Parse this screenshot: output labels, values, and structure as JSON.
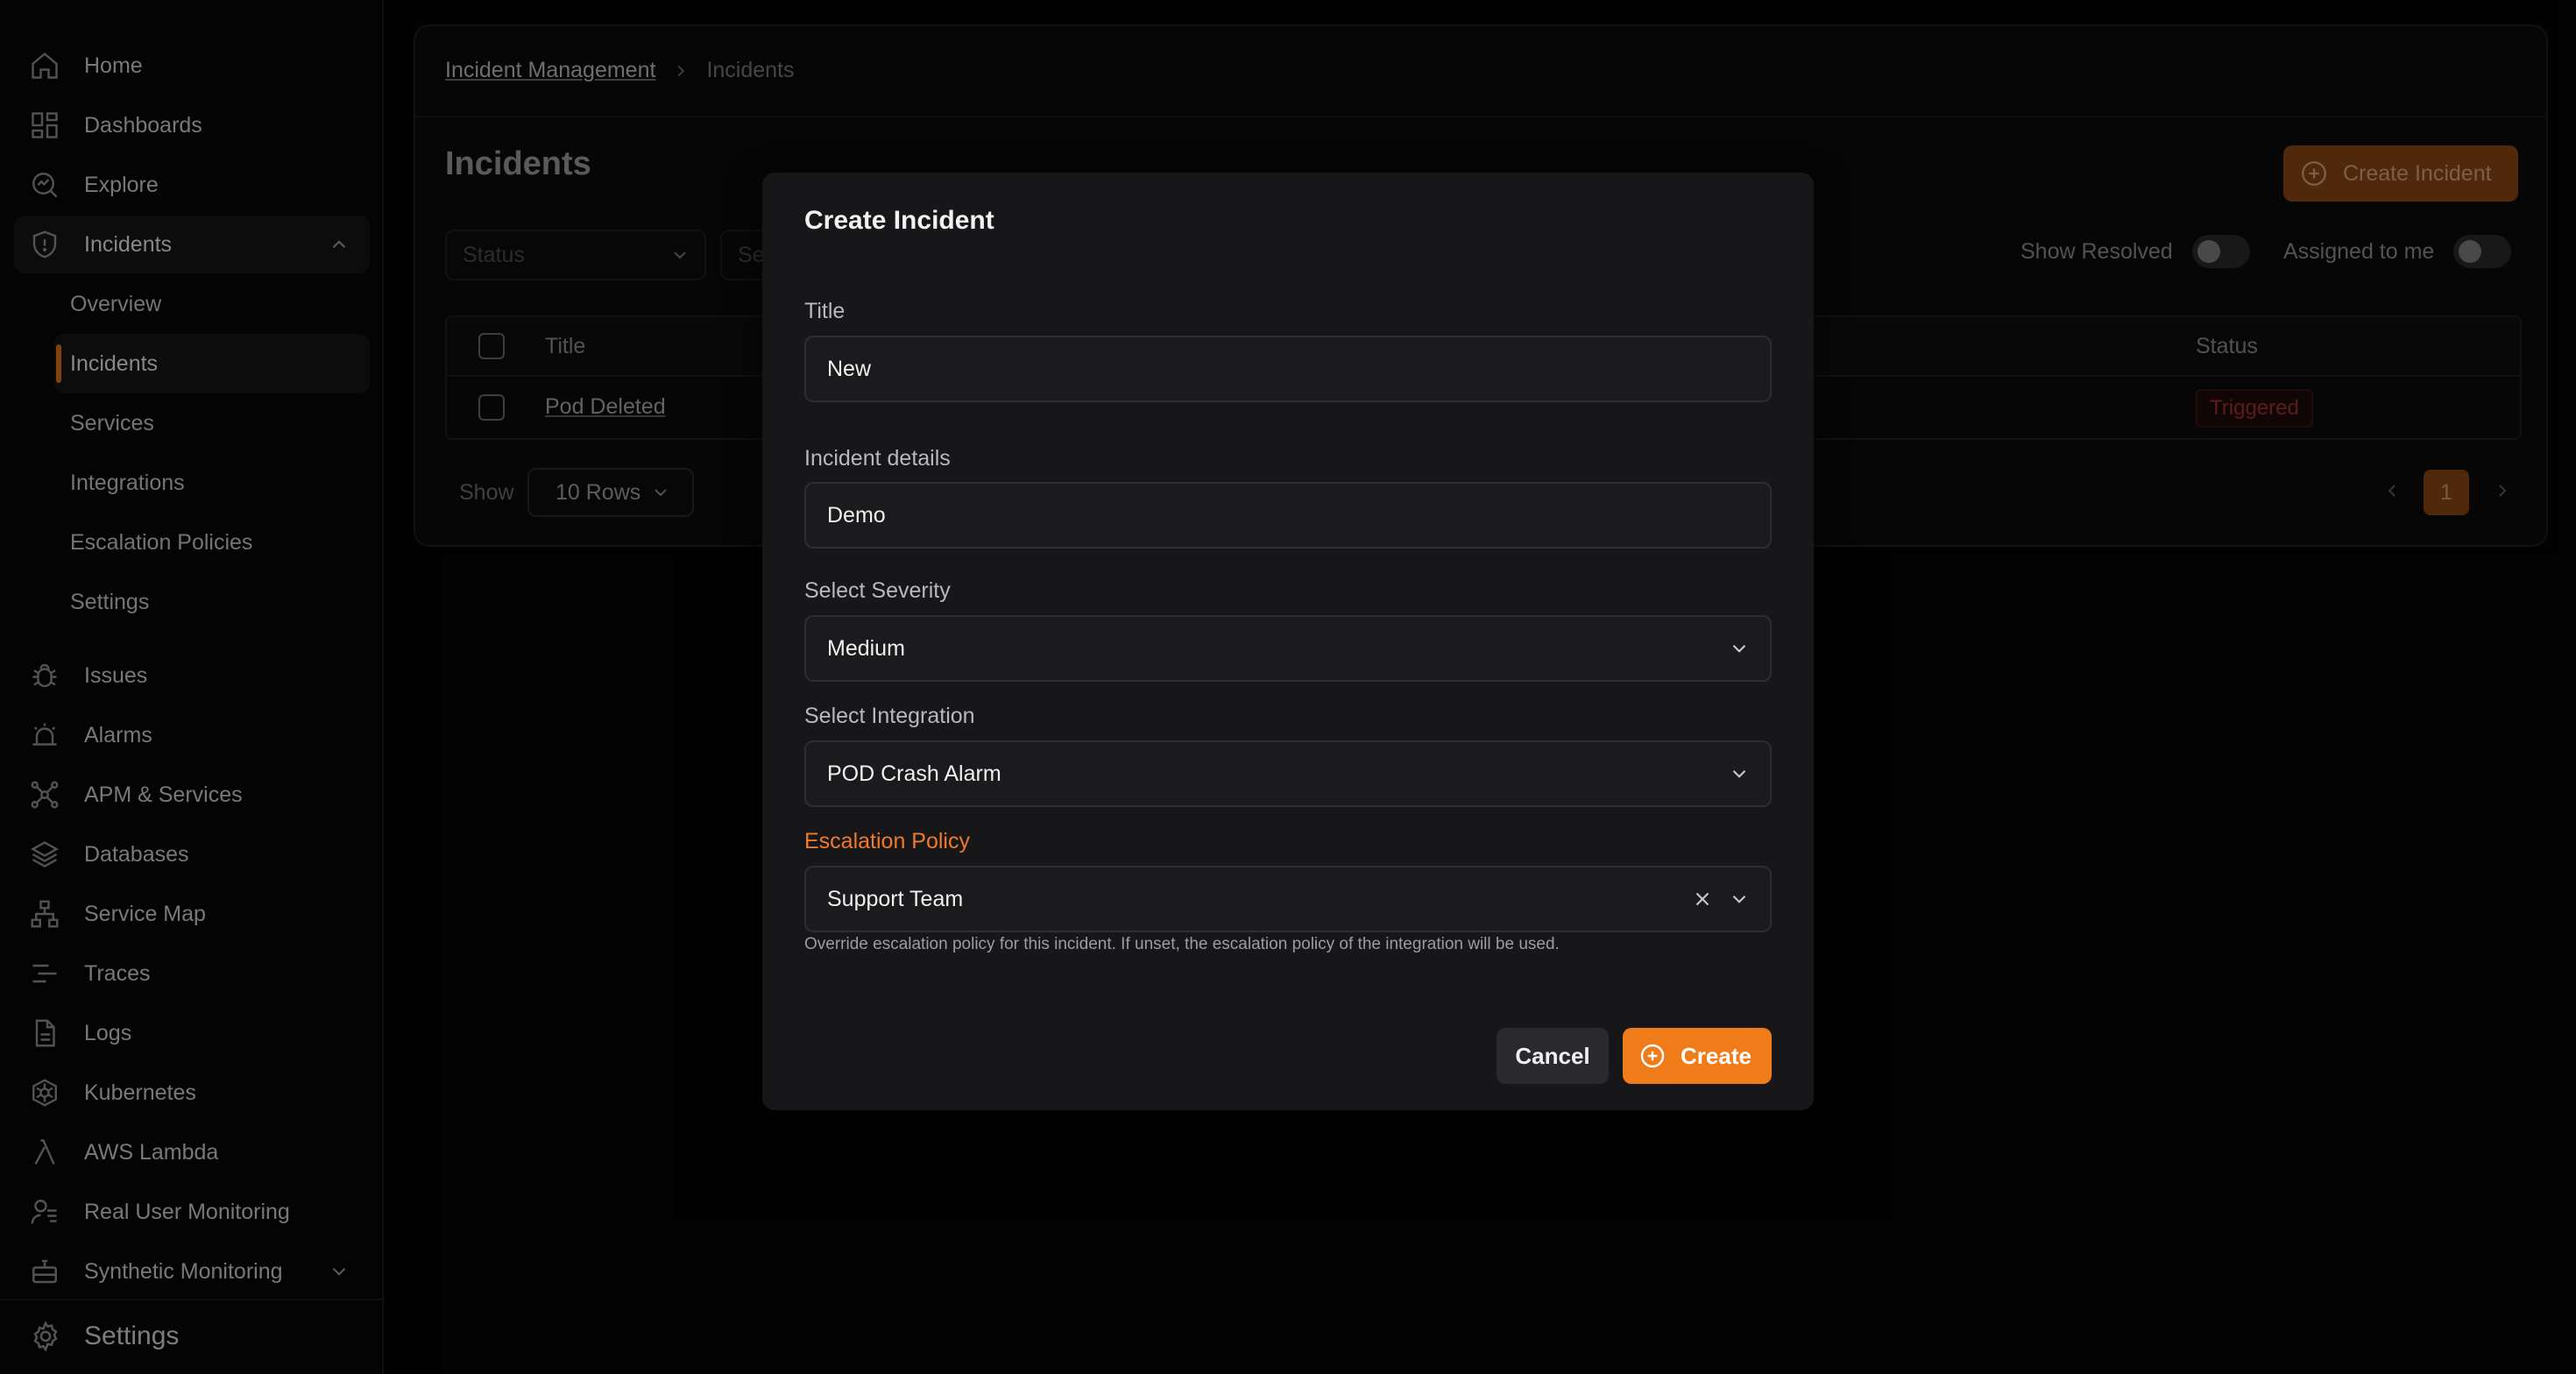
{
  "sidebar": {
    "items": [
      {
        "label": "Home",
        "icon": "home-icon"
      },
      {
        "label": "Dashboards",
        "icon": "dashboards-icon"
      },
      {
        "label": "Explore",
        "icon": "explore-icon"
      },
      {
        "label": "Incidents",
        "icon": "shield-icon",
        "expanded": true
      },
      {
        "label": "Issues",
        "icon": "bug-icon"
      },
      {
        "label": "Alarms",
        "icon": "alarm-icon"
      },
      {
        "label": "APM & Services",
        "icon": "apm-icon"
      },
      {
        "label": "Databases",
        "icon": "databases-icon"
      },
      {
        "label": "Service Map",
        "icon": "service-map-icon"
      },
      {
        "label": "Traces",
        "icon": "traces-icon"
      },
      {
        "label": "Logs",
        "icon": "logs-icon"
      },
      {
        "label": "Kubernetes",
        "icon": "kubernetes-icon"
      },
      {
        "label": "AWS Lambda",
        "icon": "lambda-icon"
      },
      {
        "label": "Real User Monitoring",
        "icon": "user-monitoring-icon"
      },
      {
        "label": "Synthetic Monitoring",
        "icon": "robot-icon"
      }
    ],
    "incidents_sub": [
      "Overview",
      "Incidents",
      "Services",
      "Integrations",
      "Escalation Policies",
      "Settings"
    ],
    "settings_label": "Settings"
  },
  "main": {
    "breadcrumb": {
      "parent": "Incident Management",
      "current": "Incidents"
    },
    "title": "Incidents",
    "create_button": "Create Incident",
    "status_filter_placeholder": "Status",
    "filter2_placeholder": "Se",
    "show_resolved": "Show Resolved",
    "assigned_to_me": "Assigned to me",
    "table": {
      "columns": [
        "Title",
        "Status"
      ],
      "rows": [
        {
          "title": "Pod Deleted",
          "status": "Triggered"
        }
      ]
    },
    "pagination": {
      "show_label": "Show",
      "rows_per_page": "10 Rows",
      "current_page": "1"
    }
  },
  "modal": {
    "title": "Create Incident",
    "fields": {
      "title_label": "Title",
      "title_value": "New",
      "details_label": "Incident details",
      "details_value": "Demo",
      "severity_label": "Select Severity",
      "severity_value": "Medium",
      "integration_label": "Select Integration",
      "integration_value": "POD Crash Alarm",
      "escalation_label": "Escalation Policy",
      "escalation_value": "Support Team",
      "escalation_help": "Override escalation policy for this incident. If unset, the escalation policy of the integration will be used."
    },
    "cancel_label": "Cancel",
    "create_label": "Create"
  },
  "colors": {
    "accent": "#f07c19",
    "warning_label": "#f07a2a",
    "triggered": "#a32f2f",
    "background": "#050505",
    "modal": "#17171a"
  }
}
